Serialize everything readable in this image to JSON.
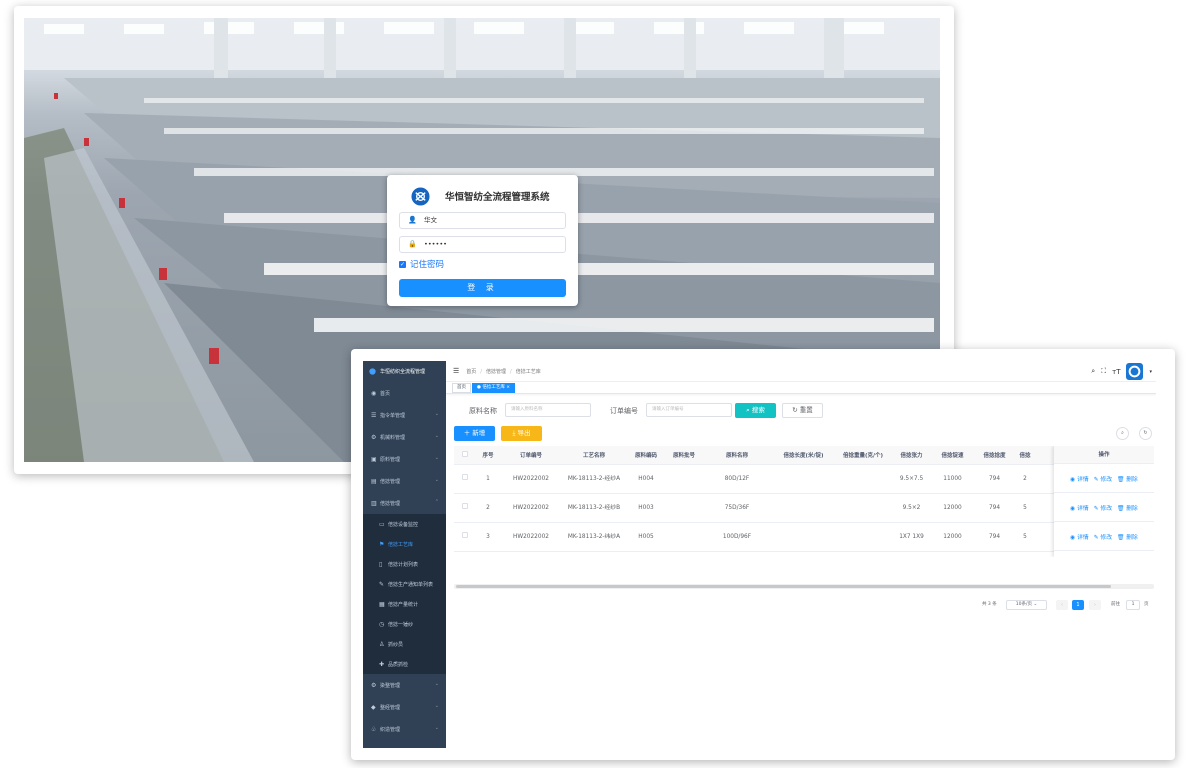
{
  "login": {
    "title": "华恒智纺全流程管理系统",
    "username": "华文",
    "password": "••••••",
    "remember_label": "记住密码",
    "login_button": "登 录",
    "accent": "#1890ff"
  },
  "app": {
    "sidebar": {
      "logo_text": "华恒纺织全流程管理",
      "bg_color": "#304156",
      "items": [
        {
          "label": "首页",
          "icon": "dashboard-icon"
        },
        {
          "label": "指令单管理",
          "icon": "list-icon"
        },
        {
          "label": "机械料管理",
          "icon": "gear-icon"
        },
        {
          "label": "原料管理",
          "icon": "box-icon"
        },
        {
          "label": "倍捻管理",
          "icon": "form-icon"
        },
        {
          "label": "倍捻管理",
          "icon": "chart-icon"
        }
      ],
      "sub_items": [
        {
          "label": "倍捻设备监控",
          "icon": "monitor-icon"
        },
        {
          "label": "倍捻工艺库",
          "icon": "flag-icon"
        },
        {
          "label": "倍捻计划列表",
          "icon": "doc-icon"
        },
        {
          "label": "倍捻生产通知单列表",
          "icon": "edit-icon"
        },
        {
          "label": "倍捻产量统计",
          "icon": "table-icon"
        },
        {
          "label": "倍捻一锤纱",
          "icon": "clock-icon"
        },
        {
          "label": "抓纱员",
          "icon": "user-icon"
        },
        {
          "label": "品质抓检",
          "icon": "plus-icon"
        }
      ],
      "bottom_items": [
        {
          "label": "染整管理",
          "icon": "settings-icon"
        },
        {
          "label": "整经管理",
          "icon": "layers-icon"
        },
        {
          "label": "织造管理",
          "icon": "loom-icon"
        }
      ]
    },
    "breadcrumb": [
      "首页",
      "倍捻管理",
      "倍捻工艺库"
    ],
    "tabs": [
      "首页",
      "倍捻工艺库"
    ],
    "filters": {
      "material_label": "原料名称",
      "material_placeholder": "请输入原料名称",
      "order_label": "订单编号",
      "order_placeholder": "请输入订单编号",
      "search_button": "搜索",
      "reset_button": "重置"
    },
    "actions": {
      "add_button": "新增",
      "export_button": "导出"
    },
    "table": {
      "columns": [
        "序号",
        "订单编号",
        "工艺名称",
        "原料编码",
        "原料批号",
        "原料名称",
        "倍捻长度(米/锭)",
        "倍捻重量(克/个)",
        "倍捻张力",
        "倍捻锭速",
        "倍捻捻度",
        "倍捻"
      ],
      "ops_header": "操作",
      "op_labels": [
        "详情",
        "修改",
        "删除"
      ],
      "rows": [
        [
          "1",
          "HW2022002",
          "MK-18113-2-经纱A",
          "H004",
          "",
          "80D/12F",
          "",
          "",
          "9.5×7.5",
          "11000",
          "794",
          "2"
        ],
        [
          "2",
          "HW2022002",
          "MK-18113-2-经纱B",
          "H003",
          "",
          "75D/36F",
          "",
          "",
          "9.5×2",
          "12000",
          "794",
          "5"
        ],
        [
          "3",
          "HW2022002",
          "MK-18113-2-纬纱A",
          "H005",
          "",
          "100D/96F",
          "",
          "",
          "1X7 1X9",
          "12000",
          "794",
          "5"
        ]
      ]
    },
    "pagination": {
      "total_text": "共 3 条",
      "page_size": "10条/页",
      "current_page": "1",
      "goto_label": "前往",
      "goto_value": "1",
      "page_suffix": "页"
    }
  }
}
